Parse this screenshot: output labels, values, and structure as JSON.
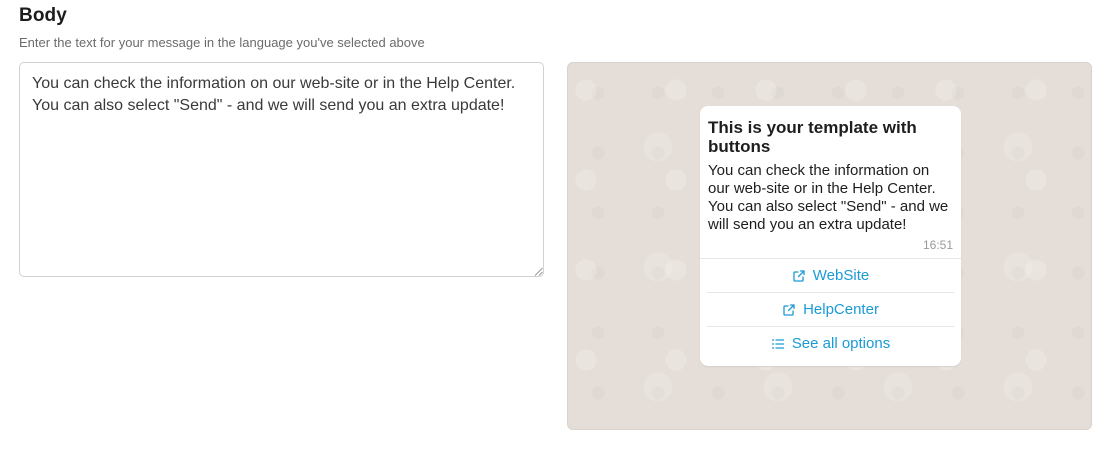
{
  "section": {
    "title": "Body",
    "subtitle": "Enter the text for your message in the language you've selected above"
  },
  "editor": {
    "value": "You can check the information on our web-site or in the Help Center.\nYou can also select \"Send\" - and we will send you an extra update!"
  },
  "preview": {
    "header": "This is your template with buttons",
    "body": "You can check the information on our web-site or in the Help Center. You can also select \"Send\" - and we will send you an extra update!",
    "time": "16:51",
    "buttons": [
      {
        "label": "WebSite",
        "icon": "external-link-icon"
      },
      {
        "label": "HelpCenter",
        "icon": "external-link-icon"
      },
      {
        "label": "See all options",
        "icon": "list-icon"
      }
    ],
    "link_color": "#1b9ad6",
    "background_color": "#e5ded8"
  }
}
